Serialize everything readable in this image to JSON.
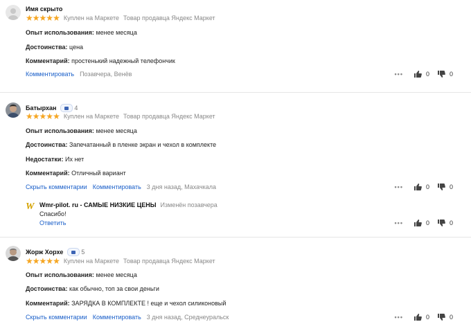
{
  "labels": {
    "experience": "Опыт использования:",
    "pros": "Достоинства:",
    "cons": "Недостатки:",
    "comment": "Комментарий:",
    "purchased": "Куплен на Маркете",
    "seller_goods": "Товар продавца Яндекс Маркет",
    "comment_action": "Комментировать",
    "hide_comments": "Скрыть комментарии",
    "more": "•••",
    "reply_action": "Ответить"
  },
  "colors": {
    "star": "#f5a623",
    "link": "#1a5fc9",
    "reply_logo": "#d4a200"
  },
  "reviews": [
    {
      "author": "Имя скрыто",
      "badge_count": "",
      "rating": 5,
      "experience": "менее месяца",
      "pros": "цена",
      "cons": "",
      "comment": "простенький надежный телефончик",
      "date_location": "Позавчера, Венёв",
      "likes": "0",
      "dislikes": "0"
    },
    {
      "author": "Батырхан",
      "badge_count": "4",
      "rating": 5,
      "experience": "менее месяца",
      "pros": "Запечатанный в пленке экран и чехол в комплекте",
      "cons": "Их нет",
      "comment": "Отличный вариант",
      "date_location": "3 дня назад, Махачкала",
      "likes": "0",
      "dislikes": "0",
      "reply": {
        "author": "Wmr-pilot. ru - САМЫЕ НИЗКИЕ ЦЕНЫ",
        "meta": "Изменён позавчера",
        "text": "Спасибо!",
        "logo_letter": "W",
        "likes": "0",
        "dislikes": "0"
      }
    },
    {
      "author": "Жорж Хорхе",
      "badge_count": "5",
      "rating": 5,
      "experience": "менее месяца",
      "pros": "как обычно, топ за свои деньги",
      "cons": "",
      "comment": "ЗАРЯДКА В КОМПЛЕКТЕ ! еще и чехол силиконовый",
      "date_location": "3 дня назад, Среднеуральск",
      "likes": "0",
      "dislikes": "0"
    }
  ]
}
